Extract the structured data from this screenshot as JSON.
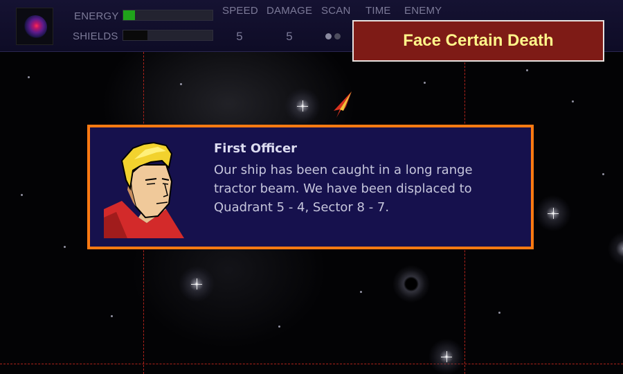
{
  "hud": {
    "energy_label": "ENERGY",
    "shields_label": "SHIELDS",
    "energy_level": 0.13,
    "shields_level": 0.27,
    "energy_color": "#1fa31a",
    "shields_color": "#0a0a0a",
    "speed_label": "SPEED",
    "damage_label": "DAMAGE",
    "scan_label": "SCAN",
    "time_label": "TIME",
    "enemy_label": "ENEMY",
    "speed_value": "5",
    "damage_value": "5",
    "ship_icon": "nebula-orb-icon"
  },
  "action": {
    "fate_button_label": "Face Certain Death",
    "fate_button_color": "#7e1b16",
    "fate_button_text_color": "#fff58a"
  },
  "dialog": {
    "speaker": "First Officer",
    "message": "Our ship has been caught in a long range tractor beam. We have been displaced to Quadrant 5 - 4, Sector 8 - 7.",
    "border_color": "#ff7a12",
    "background_color": "#16114d",
    "portrait_icon": "first-officer-portrait"
  },
  "map": {
    "grid_line_color": "#b0231b",
    "player_ship_icon": "player-ship-icon"
  }
}
